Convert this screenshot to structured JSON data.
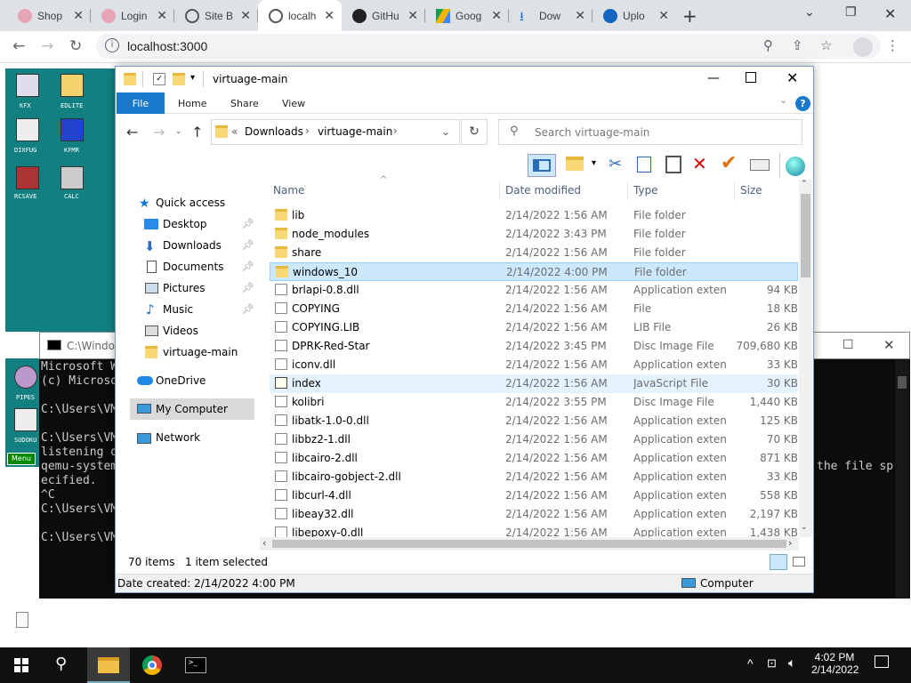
{
  "browser": {
    "tabs": [
      {
        "label": "Shop"
      },
      {
        "label": "Login"
      },
      {
        "label": "Site B"
      },
      {
        "label": "localh"
      },
      {
        "label": "GitHu"
      },
      {
        "label": "Goog"
      },
      {
        "label": "Dow"
      },
      {
        "label": "Uplo"
      }
    ],
    "url": "localhost:3000"
  },
  "desktop": {
    "icons": [
      {
        "label": "KFX"
      },
      {
        "label": "EDLITE"
      },
      {
        "label": "DIXFUG"
      },
      {
        "label": "KFMR"
      },
      {
        "label": "RCSAVE"
      },
      {
        "label": "CALC"
      },
      {
        "label": "PIPES"
      },
      {
        "label": "SUDOKU"
      }
    ],
    "menu_label": "Menu"
  },
  "cmd": {
    "title": "C:\\Windo",
    "lines": "Microsoft W\n(c) Microso\n\nC:\\Users\\VM\n\nC:\\Users\\VM\nlistening o\nqemu-system\necified.\n^C\nC:\\Users\\VM\n\nC:\\Users\\VM",
    "right_text": "the file sp"
  },
  "explorer": {
    "title": "virtuage-main",
    "ribbon_tabs": [
      "File",
      "Home",
      "Share",
      "View"
    ],
    "breadcrumb": [
      "Downloads",
      "virtuage-main"
    ],
    "breadcrumb_prefix": "«",
    "search_placeholder": "Search virtuage-main",
    "nav": {
      "quick_access": "Quick access",
      "pinned": [
        "Desktop",
        "Downloads",
        "Documents",
        "Pictures",
        "Music"
      ],
      "unpinned": [
        "Videos",
        "virtuage-main"
      ],
      "onedrive": "OneDrive",
      "my_computer": "My Computer",
      "network": "Network"
    },
    "columns": [
      "Name",
      "Date modified",
      "Type",
      "Size"
    ],
    "files": [
      {
        "name": "lib",
        "date": "2/14/2022 1:56 AM",
        "type": "File folder",
        "size": "",
        "kind": "folder"
      },
      {
        "name": "node_modules",
        "date": "2/14/2022 3:43 PM",
        "type": "File folder",
        "size": "",
        "kind": "folder"
      },
      {
        "name": "share",
        "date": "2/14/2022 1:56 AM",
        "type": "File folder",
        "size": "",
        "kind": "folder"
      },
      {
        "name": "windows_10",
        "date": "2/14/2022 4:00 PM",
        "type": "File folder",
        "size": "",
        "kind": "folder"
      },
      {
        "name": "brlapi-0.8.dll",
        "date": "2/14/2022 1:56 AM",
        "type": "Application exten...",
        "size": "94 KB",
        "kind": "doc"
      },
      {
        "name": "COPYING",
        "date": "2/14/2022 1:56 AM",
        "type": "File",
        "size": "18 KB",
        "kind": "doc"
      },
      {
        "name": "COPYING.LIB",
        "date": "2/14/2022 1:56 AM",
        "type": "LIB File",
        "size": "26 KB",
        "kind": "doc"
      },
      {
        "name": "DPRK-Red-Star",
        "date": "2/14/2022 3:45 PM",
        "type": "Disc Image File",
        "size": "709,680 KB",
        "kind": "doc"
      },
      {
        "name": "iconv.dll",
        "date": "2/14/2022 1:56 AM",
        "type": "Application exten...",
        "size": "33 KB",
        "kind": "doc"
      },
      {
        "name": "index",
        "date": "2/14/2022 1:56 AM",
        "type": "JavaScript File",
        "size": "30 KB",
        "kind": "js"
      },
      {
        "name": "kolibri",
        "date": "2/14/2022 3:55 PM",
        "type": "Disc Image File",
        "size": "1,440 KB",
        "kind": "doc"
      },
      {
        "name": "libatk-1.0-0.dll",
        "date": "2/14/2022 1:56 AM",
        "type": "Application exten...",
        "size": "125 KB",
        "kind": "doc"
      },
      {
        "name": "libbz2-1.dll",
        "date": "2/14/2022 1:56 AM",
        "type": "Application exten...",
        "size": "70 KB",
        "kind": "doc"
      },
      {
        "name": "libcairo-2.dll",
        "date": "2/14/2022 1:56 AM",
        "type": "Application exten...",
        "size": "871 KB",
        "kind": "doc"
      },
      {
        "name": "libcairo-gobject-2.dll",
        "date": "2/14/2022 1:56 AM",
        "type": "Application exten...",
        "size": "33 KB",
        "kind": "doc"
      },
      {
        "name": "libcurl-4.dll",
        "date": "2/14/2022 1:56 AM",
        "type": "Application exten...",
        "size": "558 KB",
        "kind": "doc"
      },
      {
        "name": "libeay32.dll",
        "date": "2/14/2022 1:56 AM",
        "type": "Application exten...",
        "size": "2,197 KB",
        "kind": "doc"
      },
      {
        "name": "libepoxy-0.dll",
        "date": "2/14/2022 1:56 AM",
        "type": "Application exten...",
        "size": "1,438 KB",
        "kind": "doc"
      }
    ],
    "selected_index": 3,
    "hover_index": 9,
    "status_count": "70 items",
    "status_selected": "1 item selected",
    "status_date": "Date created: 2/14/2022 4:00 PM",
    "status_location": "Computer"
  },
  "taskbar": {
    "time": "4:02 PM",
    "date": "2/14/2022"
  },
  "colors": {
    "accent": "#1979ca",
    "selection": "#cce8ff",
    "desktop": "#128080"
  }
}
